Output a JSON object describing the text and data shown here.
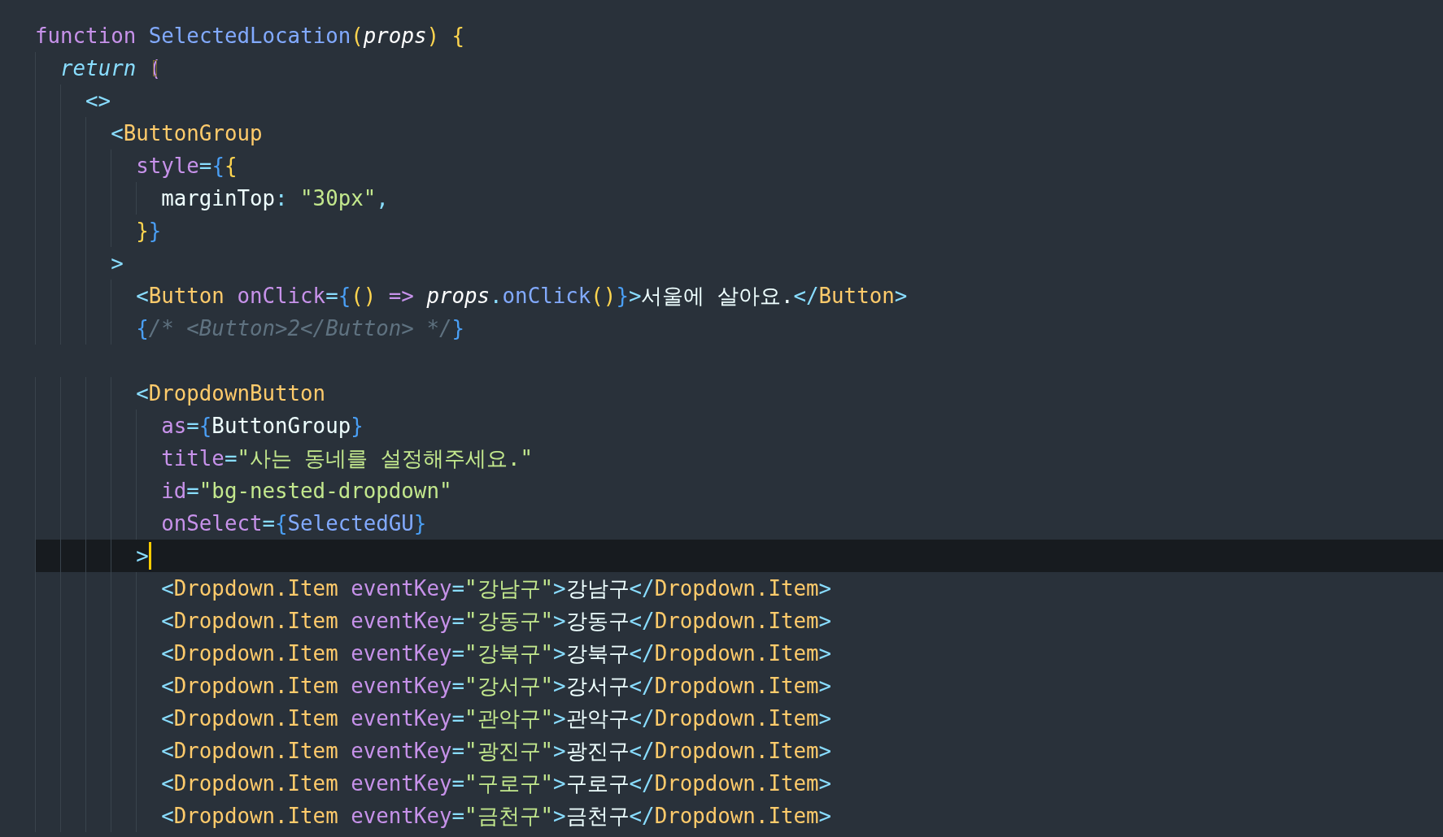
{
  "editor": {
    "lines": [
      {
        "selected": false,
        "tokens": [
          {
            "kind": "keyword",
            "text": "function "
          },
          {
            "kind": "function",
            "text": "SelectedLocation"
          },
          {
            "kind": "paren",
            "text": "("
          },
          {
            "kind": "param",
            "text": "props"
          },
          {
            "kind": "paren",
            "text": ") {"
          }
        ]
      },
      {
        "selected": false,
        "tokens": [
          {
            "kind": "return",
            "text": "  return "
          },
          {
            "kind": "match",
            "text": "("
          }
        ]
      },
      {
        "selected": false,
        "tokens": [
          {
            "kind": "tag",
            "text": "    <>"
          }
        ]
      },
      {
        "selected": false,
        "tokens": [
          {
            "kind": "tag",
            "text": "      <"
          },
          {
            "kind": "component",
            "text": "ButtonGroup"
          }
        ]
      },
      {
        "selected": false,
        "tokens": [
          {
            "kind": "attr",
            "text": "        style"
          },
          {
            "kind": "tag",
            "text": "="
          },
          {
            "kind": "brace",
            "text": "{"
          },
          {
            "kind": "paren",
            "text": "{"
          }
        ]
      },
      {
        "selected": false,
        "tokens": [
          {
            "kind": "text",
            "text": "          marginTop"
          },
          {
            "kind": "tag",
            "text": ": "
          },
          {
            "kind": "string",
            "text": "\"30px\""
          },
          {
            "kind": "tag",
            "text": ","
          }
        ]
      },
      {
        "selected": false,
        "tokens": [
          {
            "kind": "paren",
            "text": "        }"
          },
          {
            "kind": "brace",
            "text": "}"
          }
        ]
      },
      {
        "selected": false,
        "tokens": [
          {
            "kind": "tag",
            "text": "      >"
          }
        ]
      },
      {
        "selected": false,
        "tokens": [
          {
            "kind": "tag",
            "text": "        <"
          },
          {
            "kind": "component",
            "text": "Button "
          },
          {
            "kind": "attr",
            "text": "onClick"
          },
          {
            "kind": "tag",
            "text": "="
          },
          {
            "kind": "brace",
            "text": "{"
          },
          {
            "kind": "paren",
            "text": "() "
          },
          {
            "kind": "attr",
            "text": "=> "
          },
          {
            "kind": "param",
            "text": "props"
          },
          {
            "kind": "tag",
            "text": "."
          },
          {
            "kind": "function",
            "text": "onClick"
          },
          {
            "kind": "paren",
            "text": "()"
          },
          {
            "kind": "brace",
            "text": "}"
          },
          {
            "kind": "tag",
            "text": ">"
          },
          {
            "kind": "text",
            "text": "서울에 살아요."
          },
          {
            "kind": "tag",
            "text": "</"
          },
          {
            "kind": "component",
            "text": "Button"
          },
          {
            "kind": "tag",
            "text": ">"
          }
        ]
      },
      {
        "selected": false,
        "tokens": [
          {
            "kind": "brace",
            "text": "        {"
          },
          {
            "kind": "comment",
            "text": "/* <Button>2</Button> */"
          },
          {
            "kind": "brace",
            "text": "}"
          }
        ]
      },
      {
        "selected": false
      },
      {
        "selected": false,
        "tokens": [
          {
            "kind": "tag",
            "text": "        <"
          },
          {
            "kind": "component",
            "text": "DropdownButton"
          }
        ]
      },
      {
        "selected": false,
        "tokens": [
          {
            "kind": "attr",
            "text": "          as"
          },
          {
            "kind": "tag",
            "text": "="
          },
          {
            "kind": "brace",
            "text": "{"
          },
          {
            "kind": "text",
            "text": "ButtonGroup"
          },
          {
            "kind": "brace",
            "text": "}"
          }
        ]
      },
      {
        "selected": false,
        "tokens": [
          {
            "kind": "attr",
            "text": "          title"
          },
          {
            "kind": "tag",
            "text": "="
          },
          {
            "kind": "string",
            "text": "\"사는 동네를 설정해주세요.\""
          }
        ]
      },
      {
        "selected": false,
        "tokens": [
          {
            "kind": "attr",
            "text": "          id"
          },
          {
            "kind": "tag",
            "text": "="
          },
          {
            "kind": "string",
            "text": "\"bg-nested-dropdown\""
          }
        ]
      },
      {
        "selected": false,
        "tokens": [
          {
            "kind": "attr",
            "text": "          onSelect"
          },
          {
            "kind": "tag",
            "text": "="
          },
          {
            "kind": "brace",
            "text": "{"
          },
          {
            "kind": "function",
            "text": "SelectedGU"
          },
          {
            "kind": "brace",
            "text": "}"
          }
        ]
      },
      {
        "selected": true,
        "tokens": [
          {
            "kind": "tag",
            "text": "        >"
          }
        ]
      },
      {
        "selected": false,
        "tokens": [
          {
            "kind": "tag",
            "text": "          <"
          },
          {
            "kind": "component",
            "text": "Dropdown.Item "
          },
          {
            "kind": "attr",
            "text": "eventKey"
          },
          {
            "kind": "tag",
            "text": "="
          },
          {
            "kind": "string",
            "text": "\"강남구\""
          },
          {
            "kind": "tag",
            "text": ">"
          },
          {
            "kind": "text",
            "text": "강남구"
          },
          {
            "kind": "tag",
            "text": "</"
          },
          {
            "kind": "component",
            "text": "Dropdown.Item"
          },
          {
            "kind": "tag",
            "text": ">"
          }
        ]
      },
      {
        "selected": false,
        "tokens": [
          {
            "kind": "tag",
            "text": "          <"
          },
          {
            "kind": "component",
            "text": "Dropdown.Item "
          },
          {
            "kind": "attr",
            "text": "eventKey"
          },
          {
            "kind": "tag",
            "text": "="
          },
          {
            "kind": "string",
            "text": "\"강동구\""
          },
          {
            "kind": "tag",
            "text": ">"
          },
          {
            "kind": "text",
            "text": "강동구"
          },
          {
            "kind": "tag",
            "text": "</"
          },
          {
            "kind": "component",
            "text": "Dropdown.Item"
          },
          {
            "kind": "tag",
            "text": ">"
          }
        ]
      },
      {
        "selected": false,
        "tokens": [
          {
            "kind": "tag",
            "text": "          <"
          },
          {
            "kind": "component",
            "text": "Dropdown.Item "
          },
          {
            "kind": "attr",
            "text": "eventKey"
          },
          {
            "kind": "tag",
            "text": "="
          },
          {
            "kind": "string",
            "text": "\"강북구\""
          },
          {
            "kind": "tag",
            "text": ">"
          },
          {
            "kind": "text",
            "text": "강북구"
          },
          {
            "kind": "tag",
            "text": "</"
          },
          {
            "kind": "component",
            "text": "Dropdown.Item"
          },
          {
            "kind": "tag",
            "text": ">"
          }
        ]
      },
      {
        "selected": false,
        "tokens": [
          {
            "kind": "tag",
            "text": "          <"
          },
          {
            "kind": "component",
            "text": "Dropdown.Item "
          },
          {
            "kind": "attr",
            "text": "eventKey"
          },
          {
            "kind": "tag",
            "text": "="
          },
          {
            "kind": "string",
            "text": "\"강서구\""
          },
          {
            "kind": "tag",
            "text": ">"
          },
          {
            "kind": "text",
            "text": "강서구"
          },
          {
            "kind": "tag",
            "text": "</"
          },
          {
            "kind": "component",
            "text": "Dropdown.Item"
          },
          {
            "kind": "tag",
            "text": ">"
          }
        ]
      },
      {
        "selected": false,
        "tokens": [
          {
            "kind": "tag",
            "text": "          <"
          },
          {
            "kind": "component",
            "text": "Dropdown.Item "
          },
          {
            "kind": "attr",
            "text": "eventKey"
          },
          {
            "kind": "tag",
            "text": "="
          },
          {
            "kind": "string",
            "text": "\"관악구\""
          },
          {
            "kind": "tag",
            "text": ">"
          },
          {
            "kind": "text",
            "text": "관악구"
          },
          {
            "kind": "tag",
            "text": "</"
          },
          {
            "kind": "component",
            "text": "Dropdown.Item"
          },
          {
            "kind": "tag",
            "text": ">"
          }
        ]
      },
      {
        "selected": false,
        "tokens": [
          {
            "kind": "tag",
            "text": "          <"
          },
          {
            "kind": "component",
            "text": "Dropdown.Item "
          },
          {
            "kind": "attr",
            "text": "eventKey"
          },
          {
            "kind": "tag",
            "text": "="
          },
          {
            "kind": "string",
            "text": "\"광진구\""
          },
          {
            "kind": "tag",
            "text": ">"
          },
          {
            "kind": "text",
            "text": "광진구"
          },
          {
            "kind": "tag",
            "text": "</"
          },
          {
            "kind": "component",
            "text": "Dropdown.Item"
          },
          {
            "kind": "tag",
            "text": ">"
          }
        ]
      },
      {
        "selected": false,
        "tokens": [
          {
            "kind": "tag",
            "text": "          <"
          },
          {
            "kind": "component",
            "text": "Dropdown.Item "
          },
          {
            "kind": "attr",
            "text": "eventKey"
          },
          {
            "kind": "tag",
            "text": "="
          },
          {
            "kind": "string",
            "text": "\"구로구\""
          },
          {
            "kind": "tag",
            "text": ">"
          },
          {
            "kind": "text",
            "text": "구로구"
          },
          {
            "kind": "tag",
            "text": "</"
          },
          {
            "kind": "component",
            "text": "Dropdown.Item"
          },
          {
            "kind": "tag",
            "text": ">"
          }
        ]
      },
      {
        "selected": false,
        "tokens": [
          {
            "kind": "tag",
            "text": "          <"
          },
          {
            "kind": "component",
            "text": "Dropdown.Item "
          },
          {
            "kind": "attr",
            "text": "eventKey"
          },
          {
            "kind": "tag",
            "text": "="
          },
          {
            "kind": "string",
            "text": "\"금천구\""
          },
          {
            "kind": "tag",
            "text": ">"
          },
          {
            "kind": "text",
            "text": "금천구"
          },
          {
            "kind": "tag",
            "text": "</"
          },
          {
            "kind": "component",
            "text": "Dropdown.Item"
          },
          {
            "kind": "tag",
            "text": ">"
          }
        ]
      }
    ]
  }
}
